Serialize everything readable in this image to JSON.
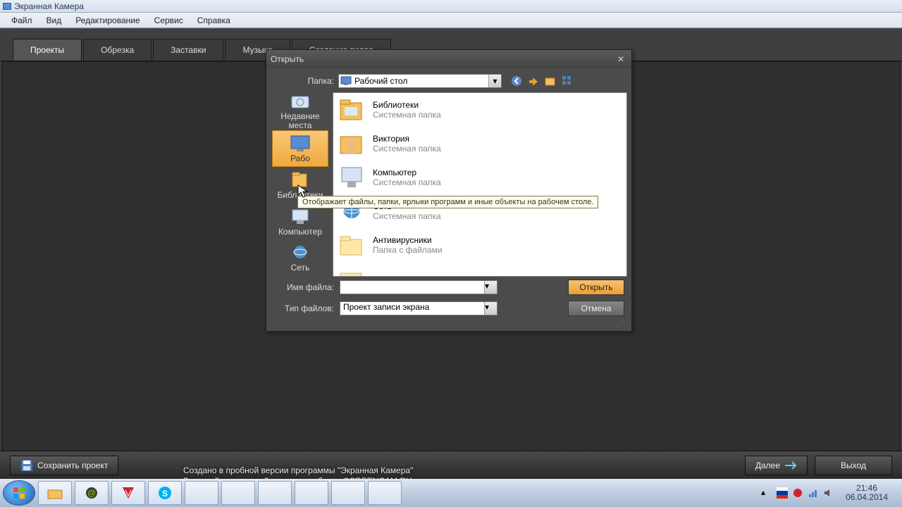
{
  "window": {
    "title": "Экранная Камера"
  },
  "menu": [
    "Файл",
    "Вид",
    "Редактирование",
    "Сервис",
    "Справка"
  ],
  "tabs": [
    "Проекты",
    "Обрезка",
    "Заставки",
    "Музыка",
    "Создание видео"
  ],
  "activeTab": 0,
  "dialog": {
    "title": "Открыть",
    "folderLabel": "Папка:",
    "folderValue": "Рабочий стол",
    "places": [
      {
        "label": "Недавние места"
      },
      {
        "label": "Рабочий стол",
        "selected": true,
        "shortLabel": "Рабо"
      },
      {
        "label": "Библиотеки"
      },
      {
        "label": "Компьютер"
      },
      {
        "label": "Сеть"
      }
    ],
    "tooltip": "Отображает файлы, папки, ярлыки программ и иные объекты на рабочем столе.",
    "items": [
      {
        "name": "Библиотеки",
        "sub": "Системная папка"
      },
      {
        "name": "Виктория",
        "sub": "Системная папка"
      },
      {
        "name": "Компьютер",
        "sub": "Системная папка"
      },
      {
        "name": "Сеть",
        "sub": "Системная папка"
      },
      {
        "name": "Антивирусники",
        "sub": "Папка с файлами"
      }
    ],
    "filenameLabel": "Имя файла:",
    "filenameValue": "",
    "filetypeLabel": "Тип файлов:",
    "filetypeValue": "Проект записи экрана",
    "openBtn": "Открыть",
    "cancelBtn": "Отмена"
  },
  "bottom": {
    "save": "Сохранить проект",
    "next": "Далее",
    "exit": "Выход"
  },
  "watermark": {
    "l1": "Создано в пробной версии программы \"Экранная Камера\"",
    "l2": "В полной версии этой надписи не будет. SCREENCAM.RU"
  },
  "clock": {
    "time": "21:46",
    "date": "06.04.2014"
  }
}
